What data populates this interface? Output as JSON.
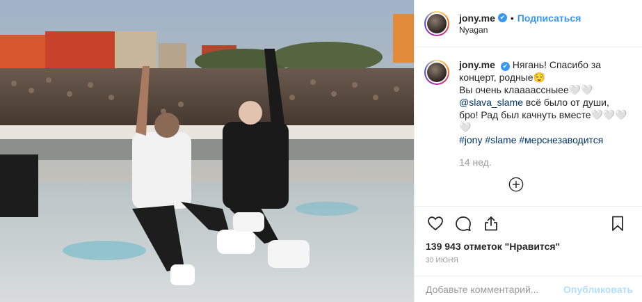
{
  "post": {
    "username": "jony.me",
    "verified_glyph": "✔",
    "dot": "•",
    "follow_label": "Подписаться",
    "location": "Nyagan"
  },
  "caption": {
    "username": "jony.me",
    "line1": "Нягань! Спасибо за концерт, родные😌",
    "line2": "Вы очень клааааcсныее🤍🤍",
    "mention": "@slava_slame",
    "line3": " всё было от души, бро! Рад был качнуть вместе🤍🤍🤍🤍",
    "tags": [
      "#jony",
      "#slame",
      "#мерснезаводится"
    ],
    "age": "14 нед."
  },
  "actions": {
    "like_icon": "heart-icon",
    "comment_icon": "comment-icon",
    "share_icon": "share-icon",
    "save_icon": "bookmark-icon",
    "load_more_icon": "plus-circle-icon"
  },
  "likes_text": "139 943 отметок \"Нравится\"",
  "date_text": "30 ИЮНЯ",
  "comment_box": {
    "placeholder": "Добавьте комментарий...",
    "post_label": "Опубликовать"
  },
  "colors": {
    "link_blue": "#3897f0",
    "hashtag": "#003569",
    "muted": "#999999",
    "post_disabled": "#b2dffc"
  }
}
